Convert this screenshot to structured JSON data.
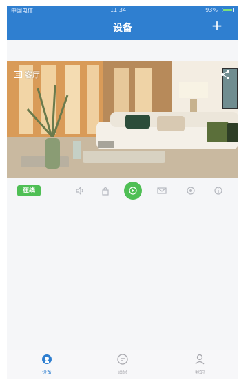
{
  "status_bar": {
    "carrier": "中国电信",
    "time": "11:34",
    "battery": "93%",
    "battery_level": 0.93
  },
  "header": {
    "title": "设备",
    "add_icon": "plus-icon"
  },
  "device": {
    "name": "客厅",
    "status": "在线",
    "image": "living-room-camera-feed"
  },
  "controls": {
    "icons": [
      "speaker-icon",
      "lock-icon",
      "video-icon",
      "mail-icon",
      "record-icon",
      "info-icon"
    ]
  },
  "tabs": [
    {
      "label": "设备",
      "icon": "device-icon",
      "active": true
    },
    {
      "label": "消息",
      "icon": "message-icon",
      "active": false
    },
    {
      "label": "我的",
      "icon": "user-icon",
      "active": false
    }
  ],
  "colors": {
    "primary": "#2f7fd0",
    "online": "#4fbf55",
    "background": "#f5f6f8"
  }
}
